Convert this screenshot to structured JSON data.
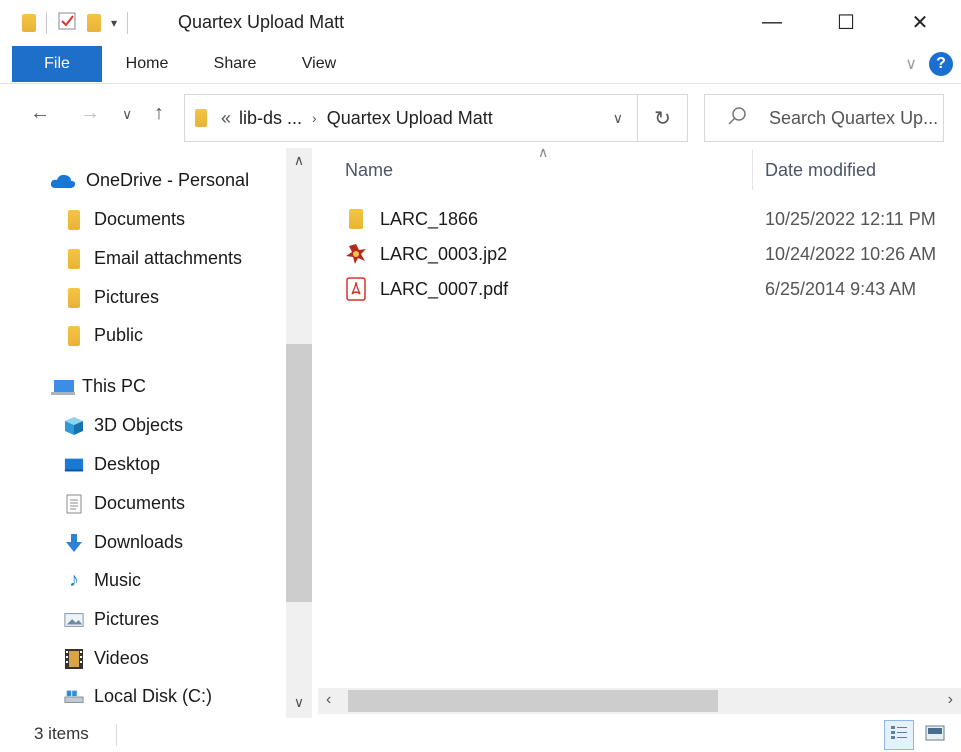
{
  "window": {
    "title": "Quartex Upload Matt",
    "minimize_glyph": "—",
    "maximize_glyph": "☐",
    "close_glyph": "✕"
  },
  "ribbon": {
    "tabs": [
      "File",
      "Home",
      "Share",
      "View"
    ],
    "help_glyph": "?"
  },
  "address": {
    "overflow": "«",
    "crumbs": [
      "lib-ds ...",
      "Quartex Upload Matt"
    ],
    "search_placeholder": "Search Quartex Up..."
  },
  "sidebar": {
    "onedrive": "OneDrive - Personal",
    "onedrive_items": [
      "Documents",
      "Email attachments",
      "Pictures",
      "Public"
    ],
    "thispc": "This PC",
    "thispc_items": [
      "3D Objects",
      "Desktop",
      "Documents",
      "Downloads",
      "Music",
      "Pictures",
      "Videos",
      "Local Disk (C:)"
    ]
  },
  "columns": {
    "name": "Name",
    "date": "Date modified"
  },
  "files": [
    {
      "name": "LARC_1866",
      "date": "10/25/2022 12:11 PM",
      "icon": "folder-icon"
    },
    {
      "name": "LARC_0003.jp2",
      "date": "10/24/2022 10:26 AM",
      "icon": "jp2-image-icon"
    },
    {
      "name": "LARC_0007.pdf",
      "date": "6/25/2014 9:43 AM",
      "icon": "pdf-icon"
    }
  ],
  "status": {
    "count": "3 items"
  },
  "colors": {
    "accent": "#1e6fc8",
    "folder": "#f5c542"
  }
}
